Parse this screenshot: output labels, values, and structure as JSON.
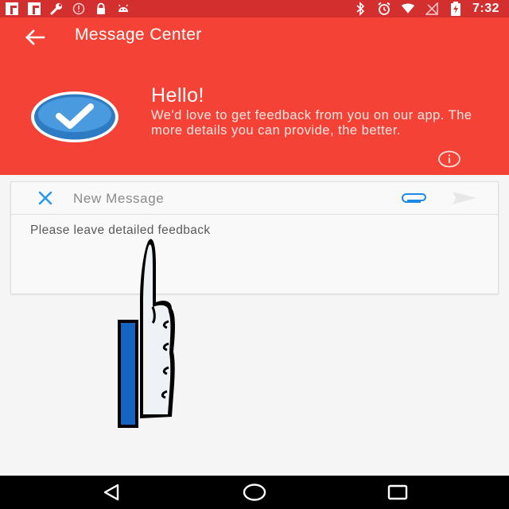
{
  "status_bar": {
    "time": "7:32",
    "left_icons": [
      "flipboard-icon",
      "flipboard-icon",
      "wrench-icon",
      "circle-alert-icon",
      "lock-icon",
      "android-icon"
    ],
    "right_icons": [
      "bluetooth-icon",
      "alarm-icon",
      "wifi-icon",
      "no-signal-icon",
      "battery-charging-icon"
    ]
  },
  "header": {
    "title": "Message Center",
    "back_icon": "arrow-left-icon",
    "background_color": "#f44336"
  },
  "greeting": {
    "title": "Hello!",
    "text": "We'd love to get feedback from you on our app. The more details you can provide, the better.",
    "info_icon": "info-circle-icon"
  },
  "composer": {
    "title": "New Message",
    "placeholder": "Please leave detailed feedback",
    "value": "",
    "close_icon": "close-x-icon",
    "attach_icon": "paperclip-icon",
    "send_icon": "send-icon",
    "accent_color": "#2196f3"
  },
  "nav_bar": {
    "buttons": [
      "back-triangle-icon",
      "home-circle-icon",
      "recents-square-icon"
    ]
  }
}
